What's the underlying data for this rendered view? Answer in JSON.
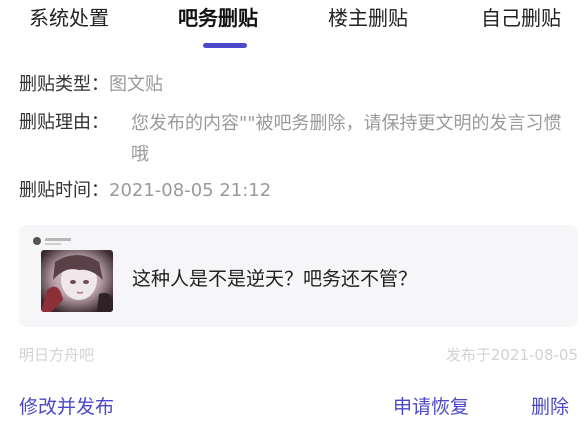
{
  "tabs": [
    {
      "label": "系统处置"
    },
    {
      "label": "吧务删贴"
    },
    {
      "label": "楼主删贴"
    },
    {
      "label": "自己删贴"
    }
  ],
  "active_tab_index": 1,
  "details": {
    "type_label": "删贴类型：",
    "type_value": "图文贴",
    "reason_label": "删贴理由：",
    "reason_value": "您发布的内容\"\"被吧务删除，请保持更文明的发言习惯哦",
    "time_label": "删贴时间：",
    "time_value": "2021-08-05 21:12"
  },
  "post_card": {
    "text": "这种人是不是逆天？吧务还不管？"
  },
  "meta": {
    "forum": "明日方舟吧",
    "published": "发布于2021-08-05"
  },
  "actions": {
    "edit_republish": "修改并发布",
    "appeal_restore": "申请恢复",
    "delete": "删除"
  },
  "colors": {
    "accent": "#4b49c9",
    "muted_text": "#9a9a9a",
    "card_bg": "#f6f6f8"
  }
}
